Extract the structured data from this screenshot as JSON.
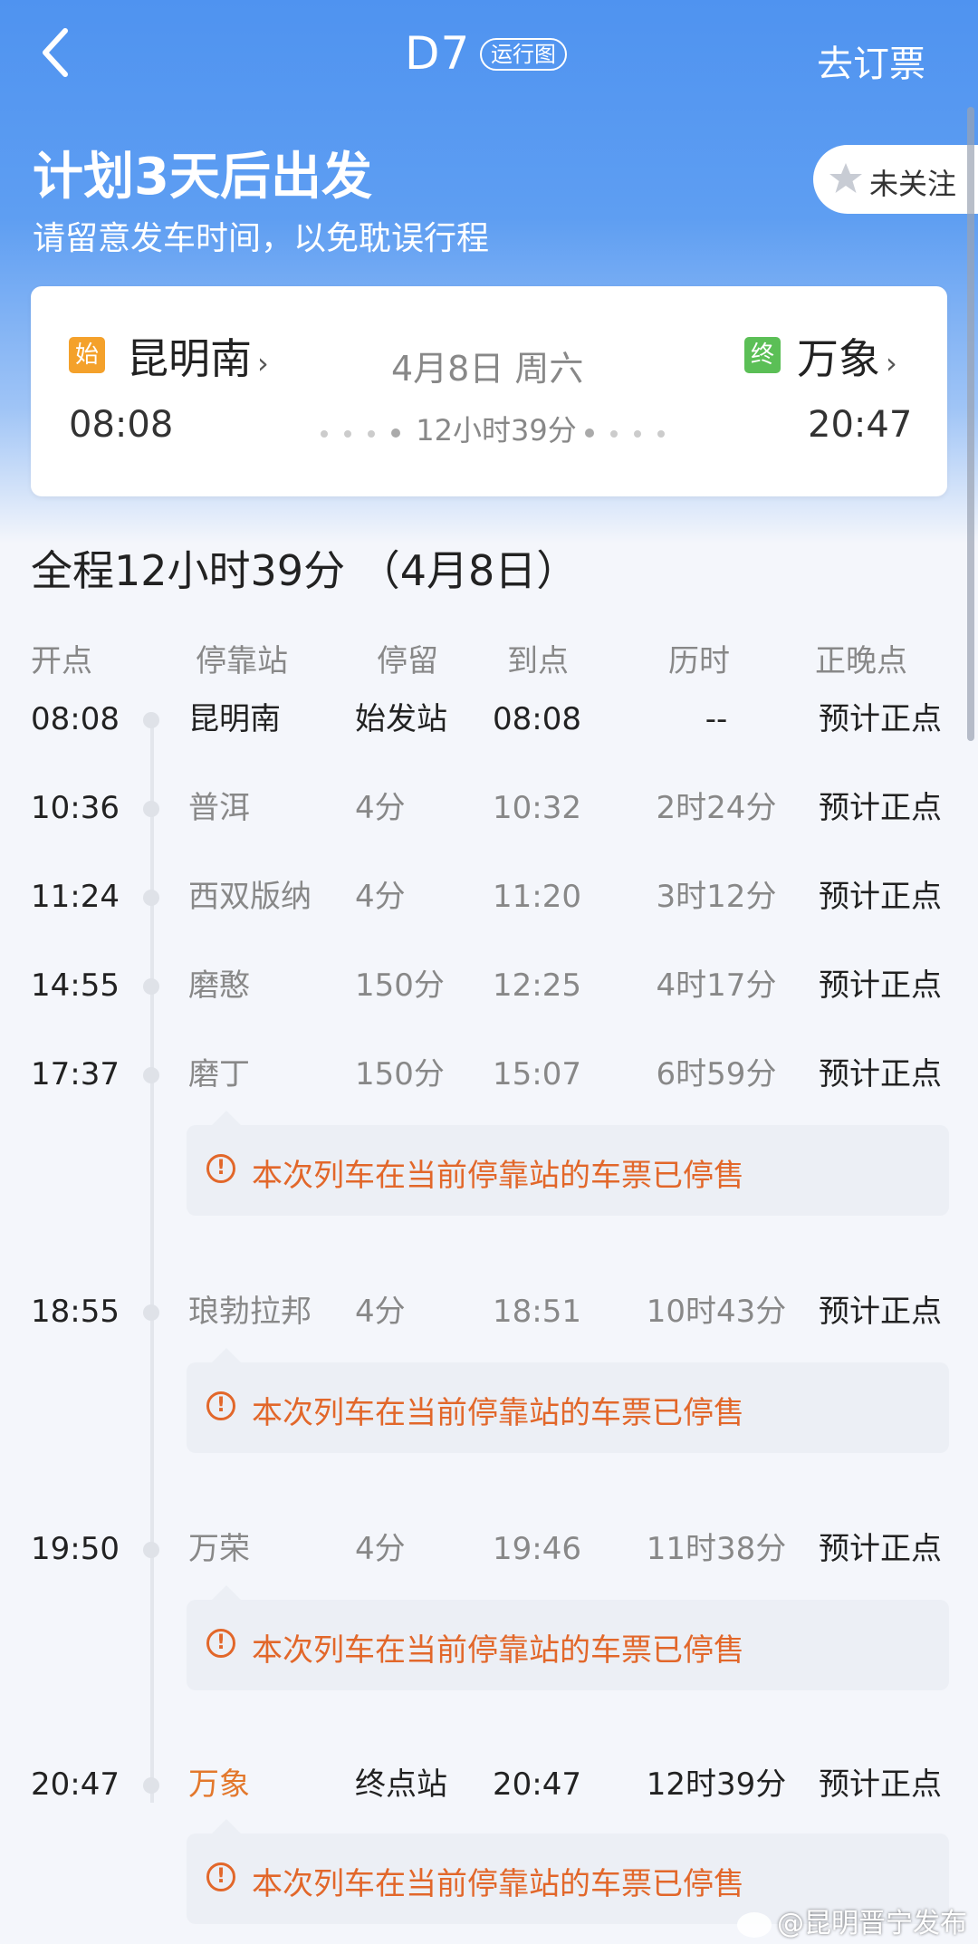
{
  "nav": {
    "title": "D7",
    "badge": "运行图",
    "book_label": "去订票",
    "back_icon": "chevron-left-icon"
  },
  "plan": {
    "title": "计划3天后出发",
    "subtitle": "请留意发车时间，以免耽误行程",
    "follow_label": "未关注",
    "follow_icon": "star-icon"
  },
  "trip_card": {
    "start_tag": "始",
    "start_station": "昆明南",
    "start_time": "08:08",
    "end_tag": "终",
    "end_station": "万象",
    "end_time": "20:47",
    "date": "4月8日 周六",
    "duration": "12小时39分"
  },
  "schedule": {
    "summary": "全程12小时39分 （4月8日）",
    "columns": [
      "开点",
      "停靠站",
      "停留",
      "到点",
      "历时",
      "正晚点"
    ],
    "stops": [
      {
        "depart": "08:08",
        "station": "昆明南",
        "stay": "始发站",
        "arrive": "08:08",
        "elapsed": "--",
        "status": "预计正点"
      },
      {
        "depart": "10:36",
        "station": "普洱",
        "stay": "4分",
        "arrive": "10:32",
        "elapsed": "2时24分",
        "status": "预计正点"
      },
      {
        "depart": "11:24",
        "station": "西双版纳",
        "stay": "4分",
        "arrive": "11:20",
        "elapsed": "3时12分",
        "status": "预计正点"
      },
      {
        "depart": "14:55",
        "station": "磨憨",
        "stay": "150分",
        "arrive": "12:25",
        "elapsed": "4时17分",
        "status": "预计正点"
      },
      {
        "depart": "17:37",
        "station": "磨丁",
        "stay": "150分",
        "arrive": "15:07",
        "elapsed": "6时59分",
        "status": "预计正点"
      },
      {
        "depart": "18:55",
        "station": "琅勃拉邦",
        "stay": "4分",
        "arrive": "18:51",
        "elapsed": "10时43分",
        "status": "预计正点"
      },
      {
        "depart": "19:50",
        "station": "万荣",
        "stay": "4分",
        "arrive": "19:46",
        "elapsed": "11时38分",
        "status": "预计正点"
      },
      {
        "depart": "20:47",
        "station": "万象",
        "stay": "终点站",
        "arrive": "20:47",
        "elapsed": "12时39分",
        "status": "预计正点"
      }
    ],
    "notice": "本次列车在当前停靠站的车票已停售",
    "notice_icon": "alert-circle-icon"
  },
  "watermark": "@昆明晋宁发布",
  "colors": {
    "header_blue": "#4f93f0",
    "notice_orange": "#e2672a",
    "start_tag": "#f4a12b",
    "end_tag": "#5bbf56",
    "end_station": "#e3782c"
  }
}
